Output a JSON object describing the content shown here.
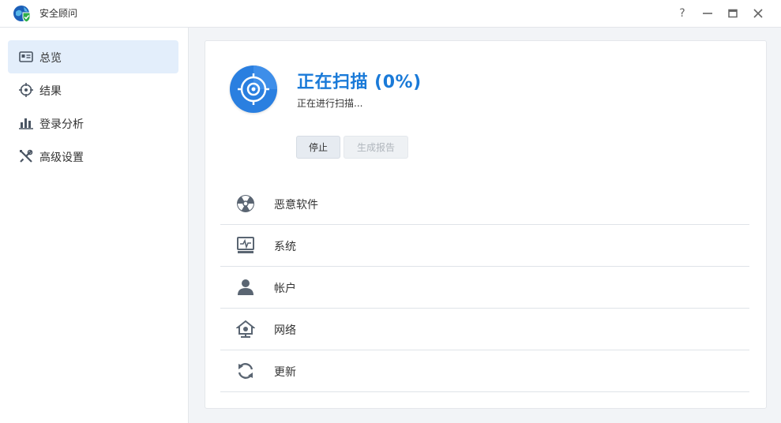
{
  "window": {
    "title": "安全顾问",
    "controls": {
      "help": "?",
      "minimize": "—",
      "maximize": "▭",
      "close": "✕"
    }
  },
  "sidebar": {
    "items": [
      {
        "label": "总览",
        "icon": "overview-card-icon",
        "active": true
      },
      {
        "label": "结果",
        "icon": "crosshair-icon",
        "active": false
      },
      {
        "label": "登录分析",
        "icon": "bar-chart-icon",
        "active": false
      },
      {
        "label": "高级设置",
        "icon": "tools-icon",
        "active": false
      }
    ]
  },
  "scan": {
    "title": "正在扫描 (0%)",
    "subtitle": "正在进行扫描...",
    "progress_percent": 0,
    "stop_label": "停止",
    "report_label": "生成报告"
  },
  "categories": [
    {
      "label": "恶意软件",
      "icon": "radiation-icon"
    },
    {
      "label": "系统",
      "icon": "system-monitor-icon"
    },
    {
      "label": "帐户",
      "icon": "user-icon"
    },
    {
      "label": "网络",
      "icon": "network-home-icon"
    },
    {
      "label": "更新",
      "icon": "refresh-icon"
    }
  ],
  "colors": {
    "accent": "#1a7ad8",
    "badge": "#2a7fe0",
    "active_nav_bg": "#e3eefb",
    "icon_gray": "#5a6572"
  }
}
